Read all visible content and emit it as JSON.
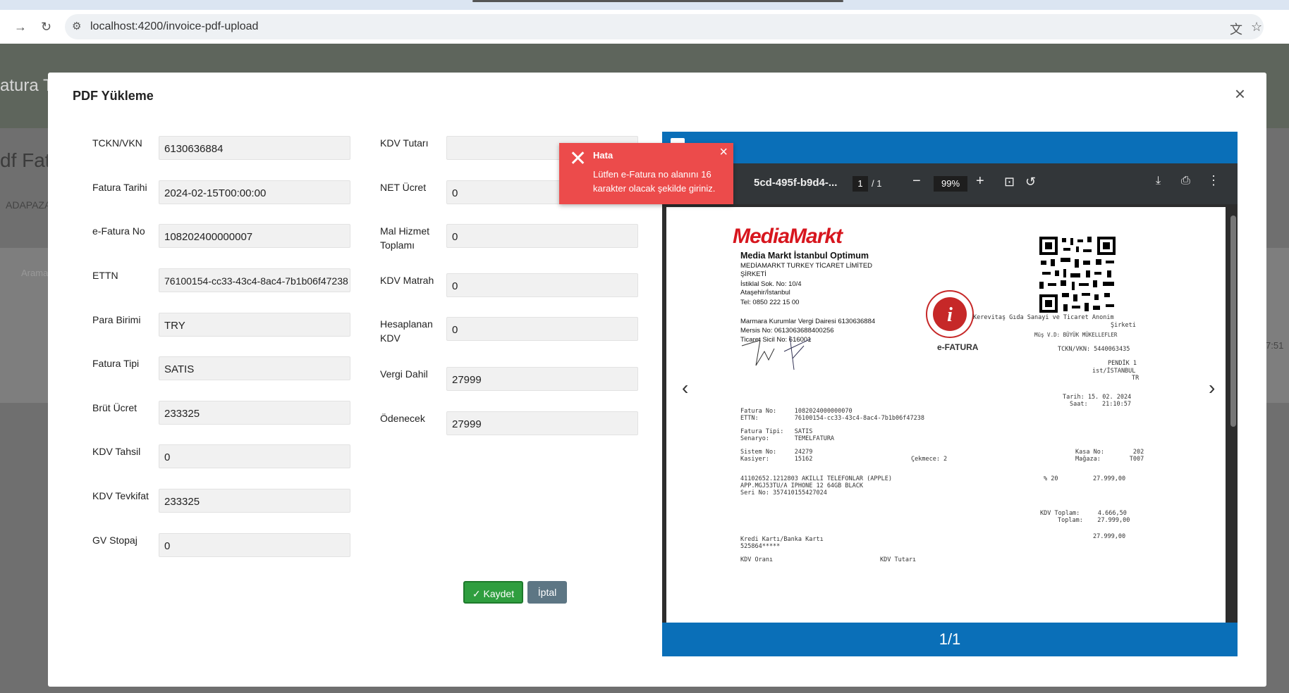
{
  "browser": {
    "url": "localhost:4200/invoice-pdf-upload",
    "back_icon": "arrow-left",
    "reload_icon": "reload",
    "site_info_icon": "tune",
    "translate_icon": "translate",
    "bookmark_icon": "star"
  },
  "background": {
    "left_title_fragment": "atura T",
    "left_subtitle_fragment": "df Fatu",
    "left_select_fragment": "ADAPAZA",
    "left_search_fragment": "Arama",
    "right_time_fragment": "7:51"
  },
  "modal": {
    "title": "PDF Yükleme",
    "close_symbol": "×"
  },
  "form": {
    "left": [
      {
        "label": "TCKN/VKN",
        "value": "6130636884"
      },
      {
        "label": "Fatura Tarihi",
        "value": "2024-02-15T00:00:00"
      },
      {
        "label": "e-Fatura No",
        "value": "108202400000007"
      },
      {
        "label": "ETTN",
        "value": "76100154-cc33-43c4-8ac4-7b1b06f47238"
      },
      {
        "label": "Para Birimi",
        "value": "TRY"
      },
      {
        "label": "Fatura Tipi",
        "value": "SATIS"
      },
      {
        "label": "Brüt Ücret",
        "value": "233325"
      },
      {
        "label": "KDV Tahsil",
        "value": "0"
      },
      {
        "label": "KDV Tevkifat",
        "value": "233325"
      },
      {
        "label": "GV Stopaj",
        "value": "0"
      }
    ],
    "right": [
      {
        "label": "KDV Tutarı",
        "value": ""
      },
      {
        "label": "NET Ücret",
        "value": "0"
      },
      {
        "label": "Mal Hizmet Toplamı",
        "value": "0"
      },
      {
        "label": "KDV Matrah",
        "value": "0"
      },
      {
        "label": "Hesaplanan KDV",
        "value": "0"
      },
      {
        "label": "Vergi Dahil",
        "value": "27999"
      },
      {
        "label": "Ödenecek",
        "value": "27999"
      }
    ],
    "save_label": "Kaydet",
    "cancel_label": "İptal",
    "save_color": "#2f9e3f",
    "cancel_color": "#5d7684"
  },
  "toast": {
    "title": "Hata",
    "message": "Lütfen e-Fatura no alanını 16 karakter olacak şekilde giriniz.",
    "color": "#ec4b4b"
  },
  "pdf_viewer": {
    "filename": "5cd-495f-b9d4-...",
    "page_current": "1",
    "page_total": "/ 1",
    "zoom": "99%",
    "footer": "1/1",
    "document": {
      "brand": "MediaMarkt",
      "store": "Media Markt İstanbul Optimum",
      "company": "MEDİAMARKT TURKEY TİCARET LİMİTED ŞİRKETİ",
      "address1": "İstiklal Sok. No: 10/4",
      "address2": "Ataşehir/İstanbul",
      "phone": "Tel: 0850 222 15 00",
      "tax_office": "Marmara Kurumlar Vergi Dairesi   6130636884",
      "mersis": "Mersis No: 0613063688400256",
      "trade_reg": "Ticaret Sicil No: 616001",
      "efatura_label": "e-FATURA",
      "buyer": "Kerevitaş Gıda Sanayi ve Ticaret Anonim",
      "buyer2": "Şirketi",
      "buyer_tax": "Müş V.D: BÜYÜK MÜKELLEFLER",
      "buyer_vkn": "TCKN/VKN: 5440063435",
      "buyer_addr1": "PENDİK 1",
      "buyer_addr2": "ist/İSTANBUL",
      "buyer_addr3": "TR",
      "date_line": "Tarih: 15. 02. 2024",
      "time_line": "Saat:    21:10:57",
      "fatura_no": "Fatura No:     1082024000000070",
      "ettn": "ETTN:          76100154-cc33-43c4-8ac4-7b1b06f47238",
      "fatura_tipi": "Fatura Tipi:   SATIS",
      "senaryo": "Senaryo:       TEMELFATURA",
      "sistem": "Sistem No:     24279",
      "kasiyer": "Kasiyer:       15162",
      "cekmece": "Çekmece: 2",
      "kasa": "Kasa No:        202",
      "magaza": "Mağaza:        T007",
      "item1": "41102652.1212803 AKILLI TELEFONLAR (APPLE)",
      "item2": "APP.MGJ53TU/A IPHONE 12 64GB BLACK",
      "item3": "Seri No: 357410155427024",
      "item_kdv": "% 20",
      "item_price": "27.999,00",
      "kdv_toplam": "KDV Toplam:     4.666,50",
      "toplam": "Toplam:    27.999,00",
      "total2": "27.999,00",
      "payment": "Kredi Kartı/Banka Kartı",
      "card": "525864*****",
      "kdv_orani": "KDV Oranı",
      "kdv_tutari": "KDV Tutarı"
    }
  }
}
